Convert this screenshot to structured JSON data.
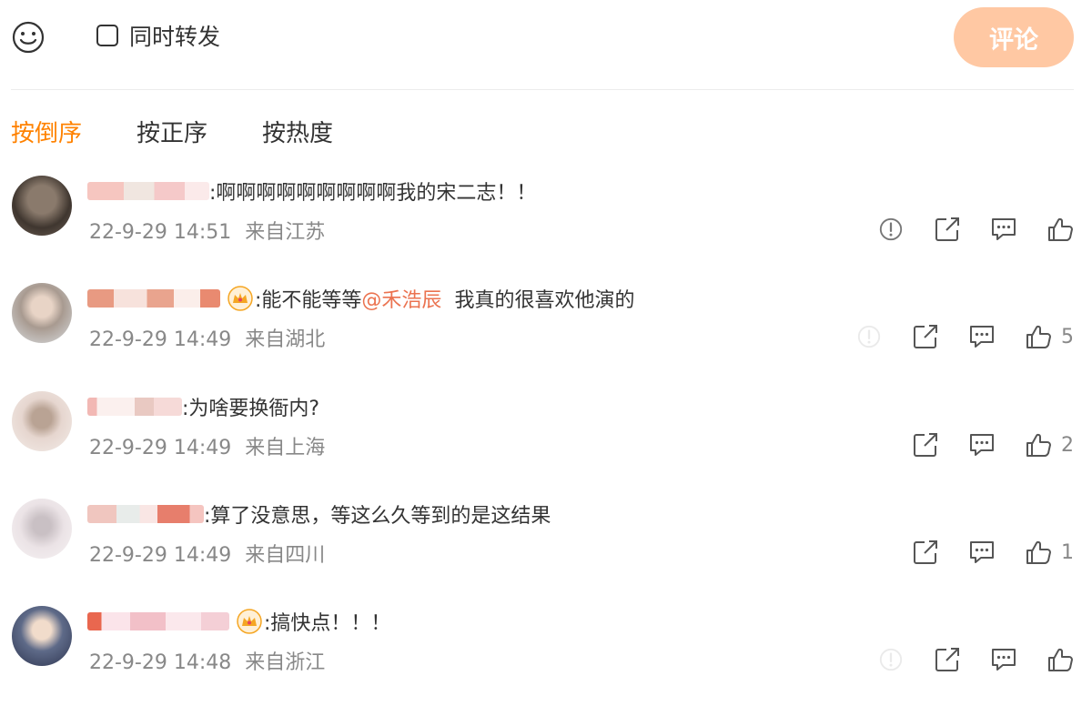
{
  "composer": {
    "repost_label": "同时转发",
    "submit_label": "评论",
    "submit_color": "#ffc8a3"
  },
  "sort": {
    "tabs": [
      {
        "label": "按倒序",
        "active": true
      },
      {
        "label": "按正序",
        "active": false
      },
      {
        "label": "按热度",
        "active": false
      }
    ],
    "active_color": "#ff8200"
  },
  "comments": [
    {
      "text": ":啊啊啊啊啊啊啊啊啊我的宋二志！！",
      "mention": "",
      "time": "22-9-29 14:51",
      "location": "来自江苏",
      "likes": "",
      "has_report": true
    },
    {
      "text": ":能不能等等",
      "mention": "@禾浩辰",
      "text_after": "我真的很喜欢他演的",
      "time": "22-9-29 14:49",
      "location": "来自湖北",
      "likes": "5",
      "has_report": false
    },
    {
      "text": ":为啥要换衙内?",
      "mention": "",
      "time": "22-9-29 14:49",
      "location": "来自上海",
      "likes": "2",
      "has_report": false
    },
    {
      "text": ":算了没意思，等这么久等到的是这结果",
      "mention": "",
      "time": "22-9-29 14:49",
      "location": "来自四川",
      "likes": "1",
      "has_report": false
    },
    {
      "text": ":搞快点！！！",
      "mention": "",
      "time": "22-9-29 14:48",
      "location": "来自浙江",
      "likes": "",
      "has_report": false
    }
  ],
  "colors": {
    "mention": "#eb7350",
    "meta": "#888888"
  }
}
